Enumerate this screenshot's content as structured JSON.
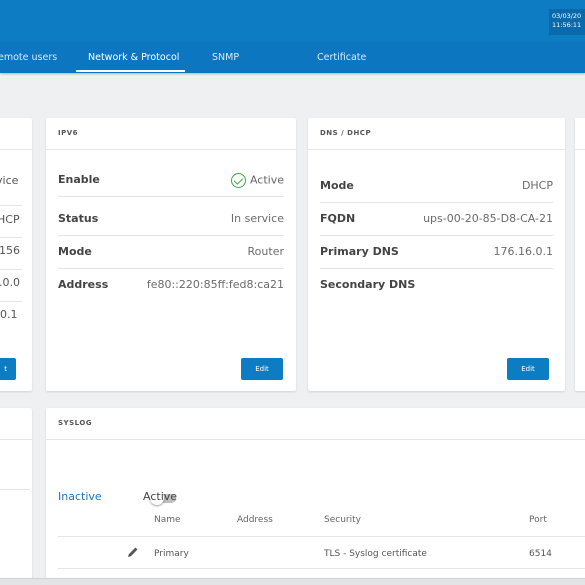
{
  "header": {
    "date": "03/03/20",
    "time": "11:56:11"
  },
  "tabs": [
    {
      "label": "emote users"
    },
    {
      "label": "Network & Protocol"
    },
    {
      "label": "SNMP"
    },
    {
      "label": "Certificate"
    }
  ],
  "left_card_fragment": {
    "values": [
      "vice",
      "HCP",
      "156",
      ".0.0",
      "0.1"
    ],
    "edit_label": "t"
  },
  "ipv6": {
    "title": "IPV6",
    "rows": [
      {
        "label": "Enable",
        "value": "Active",
        "icon": "check-circle-icon"
      },
      {
        "label": "Status",
        "value": "In service"
      },
      {
        "label": "Mode",
        "value": "Router"
      },
      {
        "label": "Address",
        "value": "fe80::220:85ff:fed8:ca21"
      }
    ],
    "edit_label": "Edit"
  },
  "dns_dhcp": {
    "title": "DNS / DHCP",
    "rows": [
      {
        "label": "Mode",
        "value": "DHCP"
      },
      {
        "label": "FQDN",
        "value": "ups-00-20-85-D8-CA-21"
      },
      {
        "label": "Primary DNS",
        "value": "176.16.0.1"
      },
      {
        "label": "Secondary DNS",
        "value": ""
      }
    ],
    "edit_label": "Edit"
  },
  "syslog": {
    "title": "SYSLOG",
    "inactive_label": "Inactive",
    "active_label": "Active",
    "toggle_state": "inactive",
    "columns": [
      "Name",
      "Address",
      "Security",
      "Port"
    ],
    "rows": [
      {
        "name": "Primary",
        "address": "",
        "security": "TLS - Syslog certificate",
        "port": "6514",
        "action_icon": "pencil-icon"
      }
    ]
  },
  "colors": {
    "header_blue": "#0e7cc2",
    "active_green": "#3aa94a",
    "link_blue": "#1a73c7"
  }
}
